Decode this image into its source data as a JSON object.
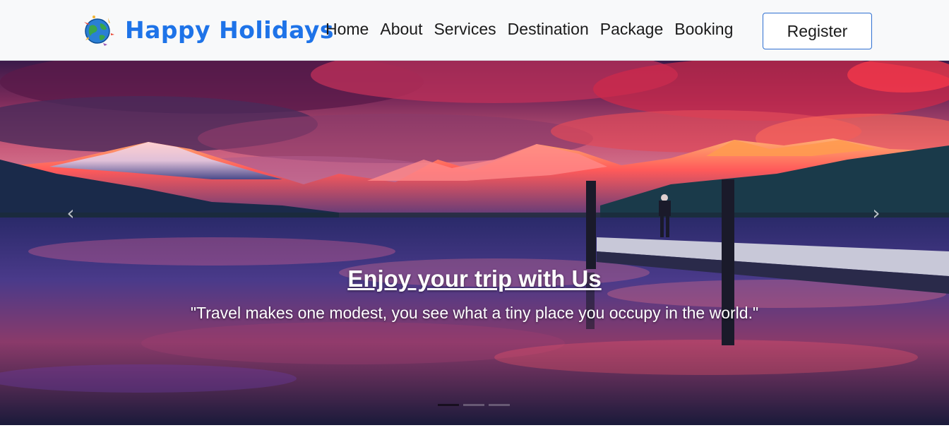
{
  "navbar": {
    "brand": "Happy Holidays",
    "logo_icon": "globe-travel-icon",
    "links": [
      {
        "label": "Home"
      },
      {
        "label": "About"
      },
      {
        "label": "Services"
      },
      {
        "label": "Destination"
      },
      {
        "label": "Package"
      },
      {
        "label": "Booking"
      }
    ],
    "register_label": "Register"
  },
  "hero": {
    "title": "Enjoy your trip with Us",
    "quote": "\"Travel makes one modest, you see what a tiny place you occupy in the world.\"",
    "image_subject": "mountain lake at sunset with pier",
    "indicators_count": 3,
    "active_index": 0,
    "prev_icon": "chevron-left-icon",
    "next_icon": "chevron-right-icon"
  },
  "colors": {
    "brand": "#1e73e8",
    "nav_text": "#1b1b1b",
    "nav_background": "#f8f9fa",
    "register_border": "#2e6fd1"
  }
}
